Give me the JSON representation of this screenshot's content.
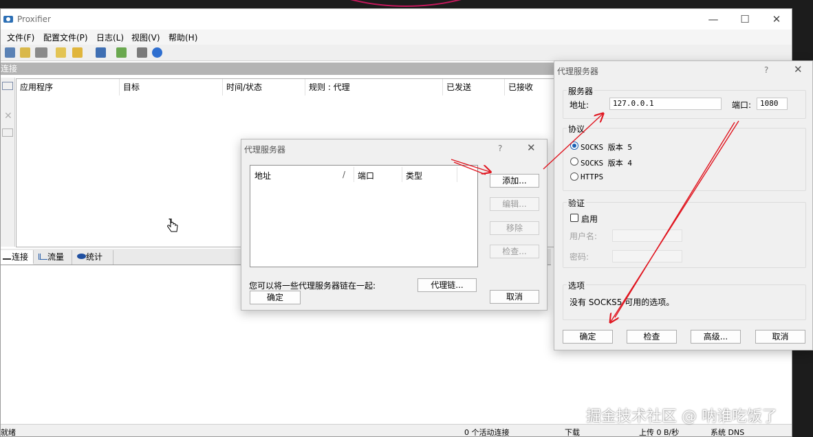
{
  "main_window": {
    "title": "Proxifier",
    "min_glyph": "—",
    "max_glyph": "☐",
    "close_glyph": "✕",
    "menu": [
      "文件(F)",
      "配置文件(P)",
      "日志(L)",
      "视图(V)",
      "帮助(H)"
    ],
    "toolbar_icons": [
      "proxy-servers-icon",
      "proxification-rules-icon",
      "name-resolution-icon",
      "new-profile-icon",
      "open-profile-icon",
      "save-profile-icon",
      "import-icon",
      "print-icon",
      "help-icon"
    ],
    "connections_header": "连接",
    "columns": [
      "应用程序",
      "目标",
      "时间/状态",
      "规则 : 代理",
      "已发送",
      "已接收"
    ],
    "tabs": [
      "连接",
      "流量",
      "统计"
    ],
    "status": {
      "left": "就绪",
      "active": "0 个活动连接",
      "download": "下载",
      "upload": "上传 0 B/秒",
      "dns": "系统 DNS"
    }
  },
  "proxy_list_dialog": {
    "title": "代理服务器",
    "help_glyph": "?",
    "close_glyph": "✕",
    "columns": [
      "地址",
      "/",
      "端口",
      "类型"
    ],
    "buttons": {
      "add": "添加...",
      "edit": "编辑...",
      "remove": "移除",
      "check": "检查...",
      "chain": "代理链...",
      "ok": "确定",
      "cancel": "取消"
    },
    "chain_hint": "您可以将一些代理服务器链在一起:"
  },
  "proxy_edit_dialog": {
    "title": "代理服务器",
    "help_glyph": "?",
    "close_glyph": "✕",
    "server_group": "服务器",
    "address_label": "地址:",
    "address_value": "127.0.0.1",
    "port_label": "端口:",
    "port_value": "1080",
    "protocol_group": "协议",
    "protocols": [
      "SOCKS 版本 5",
      "SOCKS 版本 4",
      "HTTPS"
    ],
    "selected_protocol": "SOCKS 版本 5",
    "auth_group": "验证",
    "enable_label": "启用",
    "username_label": "用户名:",
    "password_label": "密码:",
    "options_group": "选项",
    "options_text": "没有 SOCKS5 可用的选项。",
    "buttons": {
      "ok": "确定",
      "check": "检查",
      "advanced": "高级...",
      "cancel": "取消"
    }
  },
  "watermark": "掘金技术社区 @ 呐谁吃饭了",
  "colors": {
    "accent": "#1a5fb4",
    "arrow": "#e0141e",
    "header_gray": "#b4b4b4"
  }
}
